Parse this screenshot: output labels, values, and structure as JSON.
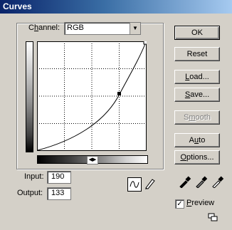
{
  "window": {
    "title": "Curves"
  },
  "channel": {
    "label": "Channel:",
    "value": "RGB"
  },
  "inputs": {
    "input_label": "Input:",
    "input_value": "190",
    "output_label": "Output:",
    "output_value": "133"
  },
  "buttons": {
    "ok": "OK",
    "reset": "Reset",
    "load": "Load...",
    "save": "Save...",
    "smooth": "Smooth",
    "auto": "Auto",
    "options": "Options..."
  },
  "preview": {
    "label": "Preview",
    "checked": true
  },
  "icons": {
    "curve_tool": "curve-icon",
    "pencil_tool": "pencil-icon",
    "black_eyedropper": "eyedropper-black-icon",
    "gray_eyedropper": "eyedropper-gray-icon",
    "white_eyedropper": "eyedropper-white-icon",
    "toggle": "swap-arrows-icon",
    "resize": "resize-icon"
  },
  "colors": {
    "title_gradient_start": "#0a246a",
    "title_gradient_end": "#a6caf0",
    "dialog_bg": "#d4d0c8"
  }
}
